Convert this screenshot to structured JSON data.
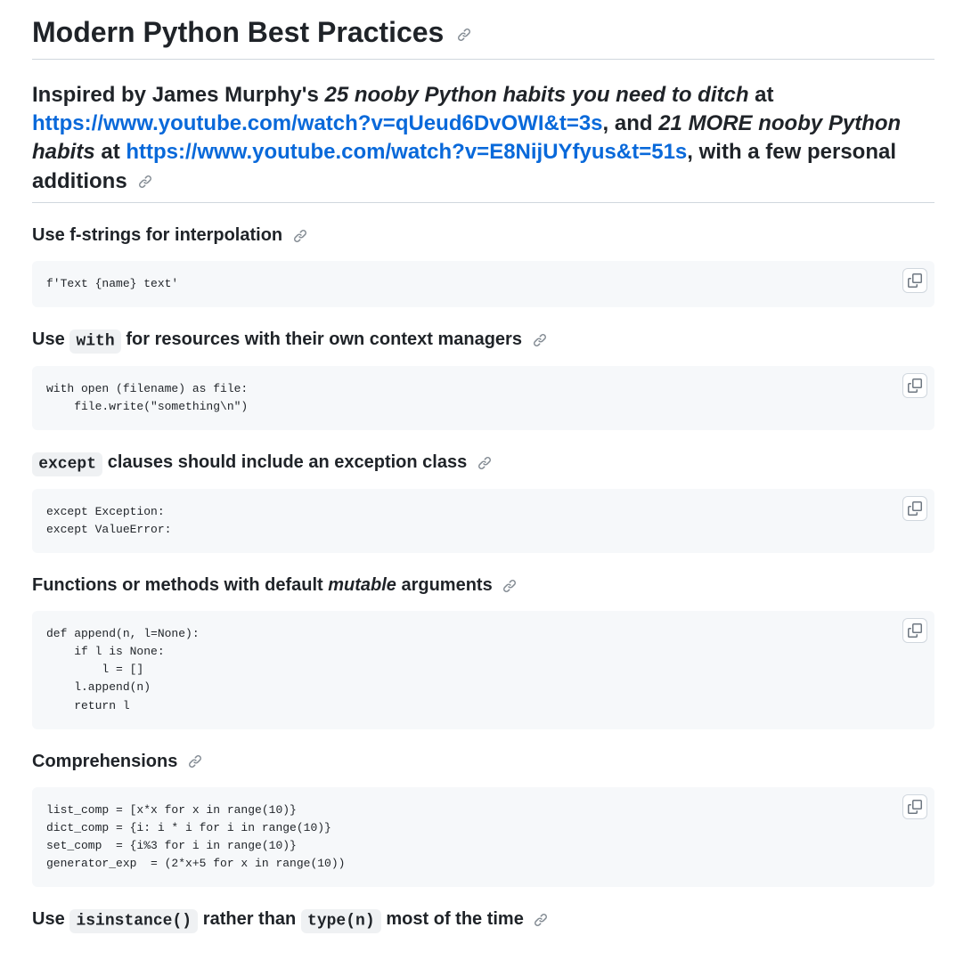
{
  "title": "Modern Python Best Practices",
  "subtitle": {
    "t1": "Inspired by James Murphy's ",
    "em1": "25 nooby Python habits you need to ditch",
    "t2": " at ",
    "link1": "https://www.youtube.com/watch?v=qUeud6DvOWI&t=3s",
    "t3": ", and ",
    "em2": "21 MORE nooby Python habits",
    "t4": " at ",
    "link2": "https://www.youtube.com/watch?v=E8NijUYfyus&t=51s",
    "t5": ", with a few personal additions"
  },
  "sections": {
    "s1": {
      "heading": "Use f-strings for interpolation",
      "code": "f'Text {name} text'"
    },
    "s2": {
      "h_before": "Use ",
      "h_code": "with",
      "h_after": " for resources with their own context managers",
      "code": "with open (filename) as file:\n    file.write(\"something\\n\")"
    },
    "s3": {
      "h_code": "except",
      "h_after": " clauses should include an exception class",
      "code": "except Exception:\nexcept ValueError:"
    },
    "s4": {
      "h_before": "Functions or methods with default ",
      "h_em": "mutable",
      "h_after": " arguments",
      "code": "def append(n, l=None):\n    if l is None:\n        l = []\n    l.append(n)\n    return l"
    },
    "s5": {
      "heading": "Comprehensions",
      "code": "list_comp = [x*x for x in range(10)}\ndict_comp = {i: i * i for i in range(10)}\nset_comp  = {i%3 for i in range(10)}\ngenerator_exp  = (2*x+5 for x in range(10))"
    },
    "s6": {
      "h_before": "Use ",
      "h_code1": "isinstance()",
      "h_mid": " rather than ",
      "h_code2": "type(n)",
      "h_after": " most of the time"
    }
  },
  "icons": {
    "anchor": "link-icon",
    "copy": "copy-icon"
  }
}
